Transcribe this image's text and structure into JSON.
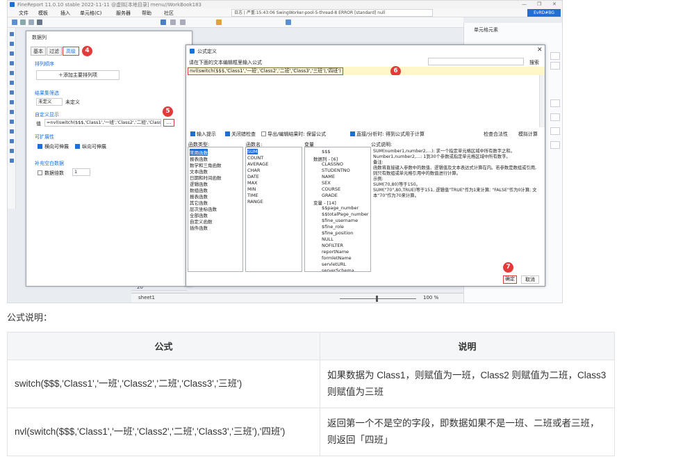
{
  "app": {
    "title": "FineReport 11.0.10 stable 2022-11-11 @虚拟[本地目录]   menu//WorkBook183",
    "menu": [
      "文件",
      "模板",
      "插入",
      "单元格(C)",
      "服务器",
      "帮助",
      "社区"
    ],
    "status_text": "日志 | 严重:15:43:06 SwingWorker-pool-5-thread-8 ERROR [standard] null",
    "user": "EvRD#BG",
    "right_panel_title": "单元格元素",
    "sheet_tab": "sheet1",
    "zoom": "100 %",
    "row_numbers": [
      "19",
      "20"
    ]
  },
  "data_column_dialog": {
    "title": "数据列",
    "tabs": [
      "基本",
      "过滤",
      "高级"
    ],
    "sort_section": "排列顺序",
    "add_sort_button": "添加主要排列项",
    "result_filter_section": "结果集筛选",
    "filter_value": "未定义",
    "filter_value_label": "未定义",
    "custom_display_section": "自定义显示",
    "value_label": "值",
    "custom_value": "=nvl(switch($$$,'Class1','一班','Class2','二班','Class3','三班'),'四班')",
    "expand_button": "...",
    "expand_attr_section": "可扩展性",
    "expand_h": "横向可伸展",
    "expand_v": "纵向可伸展",
    "supplement_section": "补充空白数据",
    "multiple_label": "数据倍数",
    "multiple_value": "1"
  },
  "formula_dialog": {
    "title": "公式定义",
    "prompt": "请在下面的文本编辑框里输入公式",
    "search_button": "搜索",
    "formula": "nvl(switch($$$,'Class1','一班','Class2','二班','Class3','三班'),'四班')",
    "options": [
      "输入提示",
      "关闭错检查",
      "导出/编辑结果时: 保留公式",
      "直接/分析时: 得到公式用于计算"
    ],
    "check_button": "检查合法性",
    "calc_button": "模拟计算",
    "col_headers": [
      "函数类型:",
      "函数名:",
      "变量",
      "公式说明:"
    ],
    "func_types": [
      "常用函数",
      "报表函数",
      "数学和三角函数",
      "文本函数",
      "日期和时间函数",
      "逻辑函数",
      "数组函数",
      "报表函数",
      "其它函数",
      "层次坐标函数",
      "全部函数",
      "自定义函数",
      "插件函数"
    ],
    "func_names": [
      "SUM",
      "COUNT",
      "AVERAGE",
      "CHAR",
      "DATE",
      "MAX",
      "MIN",
      "TIME",
      "RANGE"
    ],
    "variables": [
      "$$$",
      "数据列 - [6]",
      "CLASSNO",
      "STUDENTNO",
      "NAME",
      "SEX",
      "COURSE",
      "GRADE",
      "变量 - [14]",
      "$$page_number",
      "$$totalPage_number",
      "$fine_username",
      "$fine_role",
      "$fine_position",
      "NULL",
      "NOFILTER",
      "reportName",
      "formletName",
      "servletURL",
      "serverSchema"
    ],
    "description_lines": [
      "SUM(number1,number2,…): 求一个指定单元格区域中所有数字之和。",
      "Number1,number2,…: 1到30个参数或指定单元格区域中所有数字。",
      "备注:",
      "函数将直接键入参数中的数值、逻辑值及文本表达式计算在内。若参数是数组或引用,则只有数组或单元格引用中的数值进行计算。",
      "示例:",
      "SUM(70,80)等于150。",
      "SUM(\"70\",80,TRUE)等于151, 逻辑值\"TRUE\"作为1来计算; \"FALSE\"作为0计算; 文本\"70\"作为70来计算。"
    ],
    "ok": "确定",
    "cancel": "取消"
  },
  "badges": [
    "4",
    "5",
    "6",
    "7"
  ],
  "doc": {
    "caption": "公式说明：",
    "table": {
      "headers": [
        "公式",
        "说明"
      ],
      "rows": [
        [
          "switch($$$,'Class1','一班','Class2','二班','Class3','三班')",
          "如果数据为 Class1，则赋值为一班，Class2 则赋值为二班，Class3 则赋值为三班"
        ],
        [
          "nvl(switch($$$,'Class1','一班','Class2','二班','Class3','三班'),'四班')",
          "返回第一个不是空的字段，即数据如果不是一班、二班或者三班，则返回「四班」"
        ]
      ]
    }
  }
}
